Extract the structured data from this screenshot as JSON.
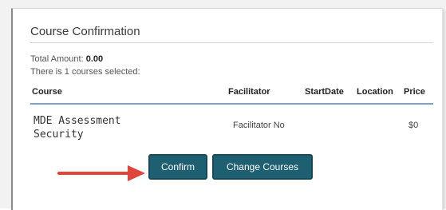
{
  "panel": {
    "title": "Course Confirmation",
    "total_label": "Total Amount:",
    "total_value": "0.00",
    "selected_text": "There is 1 courses selected:"
  },
  "table": {
    "headers": {
      "course": "Course",
      "facilitator": "Facilitator",
      "start_date": "StartDate",
      "location": "Location",
      "price": "Price"
    },
    "rows": [
      {
        "course": "MDE Assessment Security",
        "facilitator": "Facilitator No",
        "start_date": "",
        "location": "",
        "price": "$0"
      }
    ]
  },
  "actions": {
    "confirm_label": "Confirm",
    "change_label": "Change Courses"
  },
  "colors": {
    "button_bg": "#1f5f72",
    "arrow": "#e0453a",
    "header_rule": "#7fa1c6"
  },
  "icons": {
    "pointer": "red-arrow-right-icon"
  }
}
